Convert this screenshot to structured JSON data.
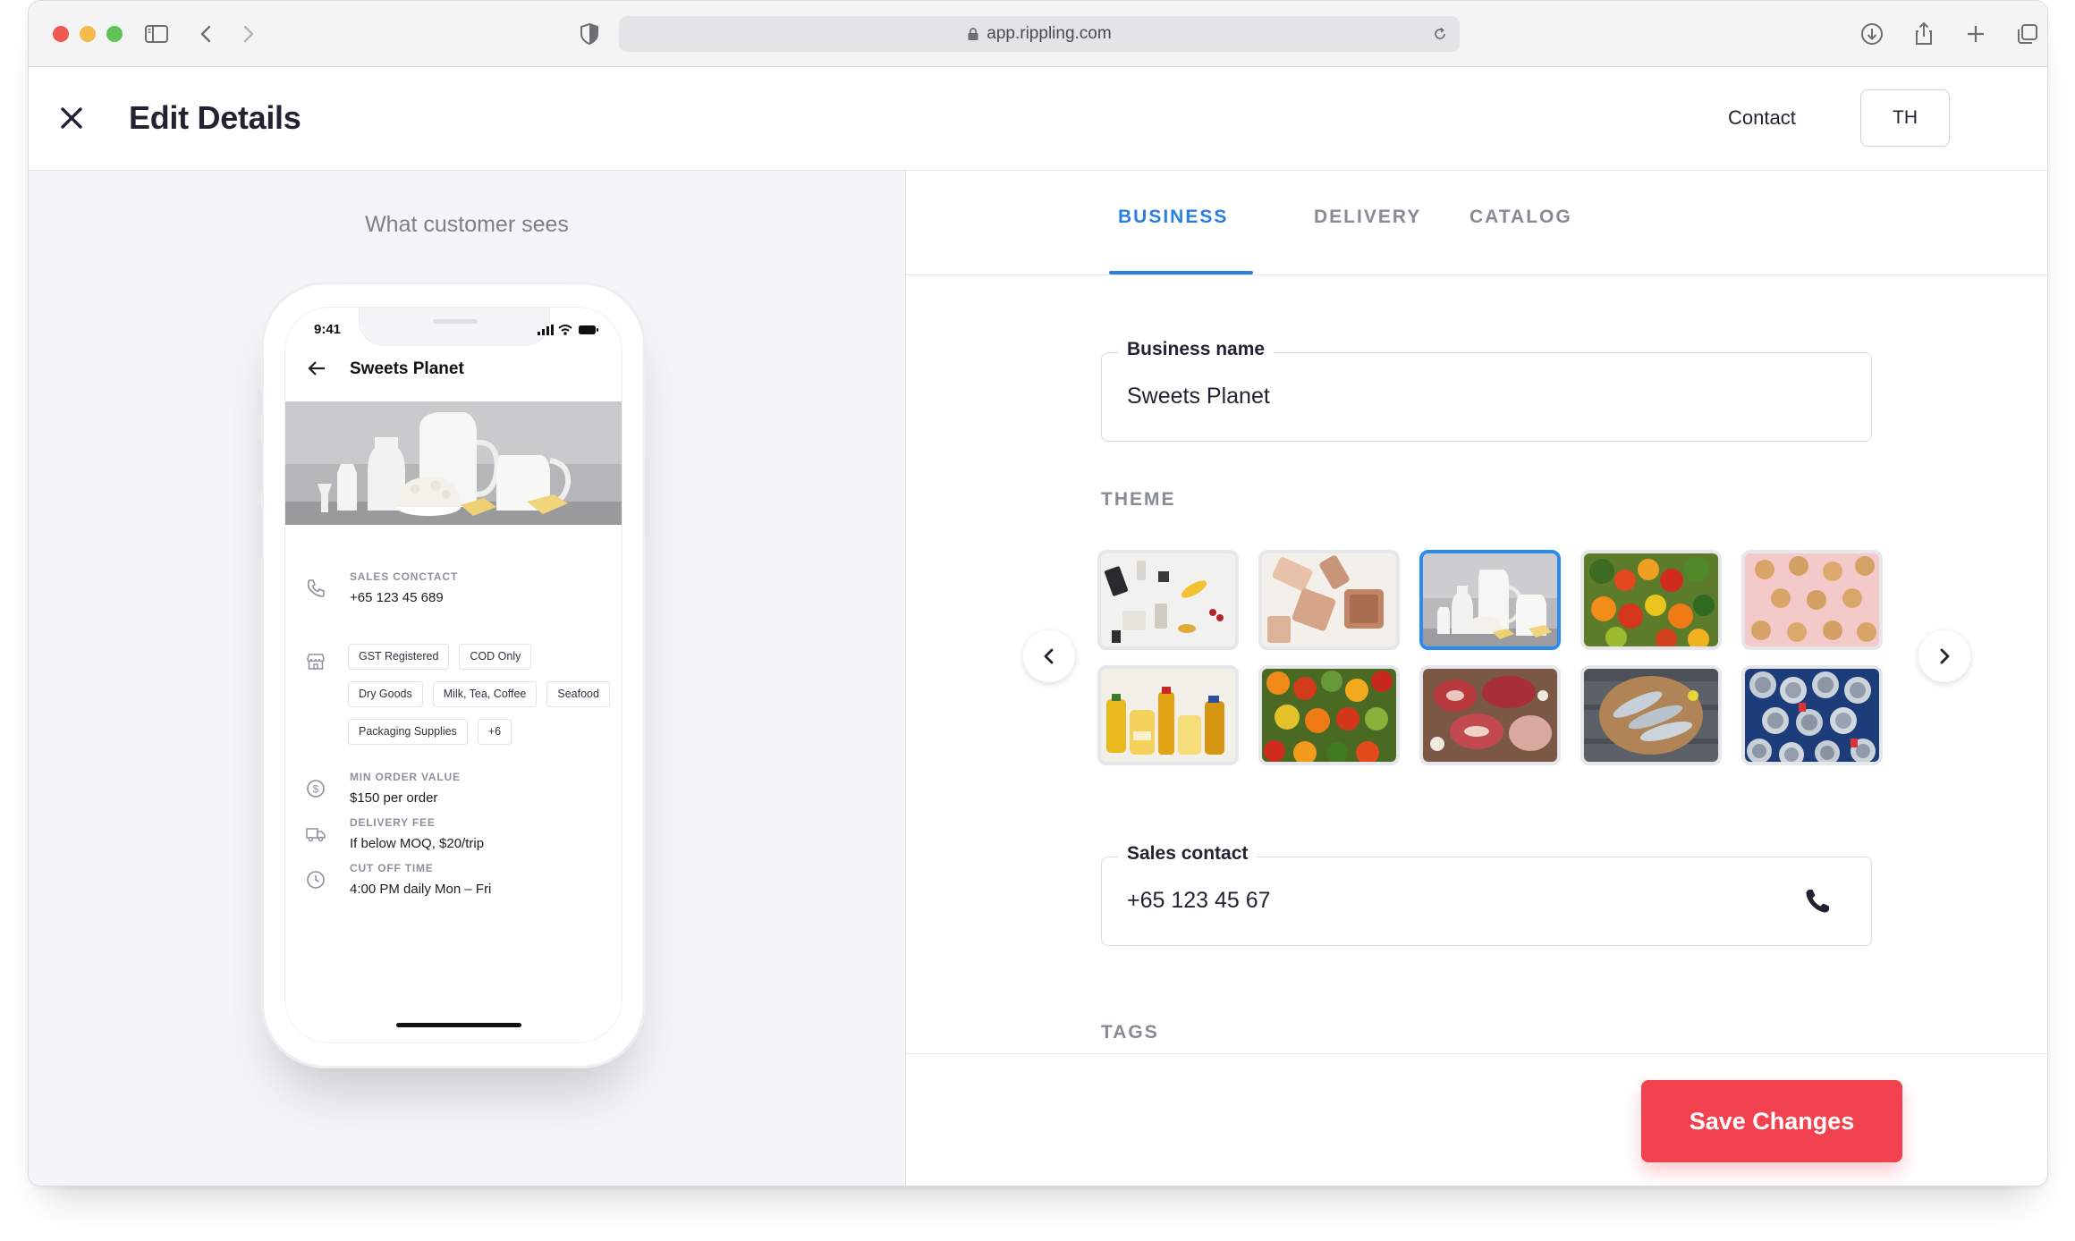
{
  "browser": {
    "url": "app.rippling.com"
  },
  "header": {
    "title": "Edit Details",
    "contact_label": "Contact",
    "avatar_initials": "TH"
  },
  "preview": {
    "title": "What customer sees",
    "phone": {
      "time": "9:41",
      "store_name": "Sweets Planet",
      "sales_contact_label": "SALES CONCTACT",
      "sales_contact_value": "+65 123 45 689",
      "tags": [
        "GST Registered",
        "COD Only",
        "Dry Goods",
        "Milk, Tea, Coffee",
        "Seafood",
        "Packaging Supplies",
        "+6"
      ],
      "min_order_label": "MIN ORDER VALUE",
      "min_order_value": "$150 per order",
      "delivery_fee_label": "DELIVERY FEE",
      "delivery_fee_value": "If below MOQ, $20/trip",
      "cutoff_label": "CUT OFF TIME",
      "cutoff_value": "4:00 PM daily Mon – Fri"
    }
  },
  "tabs": [
    {
      "label": "BUSINESS",
      "active": true
    },
    {
      "label": "DELIVERY",
      "active": false
    },
    {
      "label": "CATALOG",
      "active": false
    }
  ],
  "form": {
    "business_name_label": "Business name",
    "business_name_value": "Sweets Planet",
    "theme_label": "THEME",
    "themes": [
      {
        "name": "stationery-flatlay",
        "selected": false
      },
      {
        "name": "packaging-boxes",
        "selected": false
      },
      {
        "name": "dairy-milk",
        "selected": true
      },
      {
        "name": "vegetables",
        "selected": false
      },
      {
        "name": "cookies-pink",
        "selected": false
      },
      {
        "name": "oils-bottles",
        "selected": false
      },
      {
        "name": "fruits-vegetables",
        "selected": false
      },
      {
        "name": "raw-meat",
        "selected": false
      },
      {
        "name": "fish-board",
        "selected": false
      },
      {
        "name": "soda-cans",
        "selected": false
      }
    ],
    "sales_contact_label": "Sales contact",
    "sales_contact_value": "+65 123 45 67",
    "tags_label": "TAGS"
  },
  "actions": {
    "save_label": "Save Changes"
  },
  "colors": {
    "accent": "#2b7fe0",
    "save_button": "#f2424f"
  }
}
